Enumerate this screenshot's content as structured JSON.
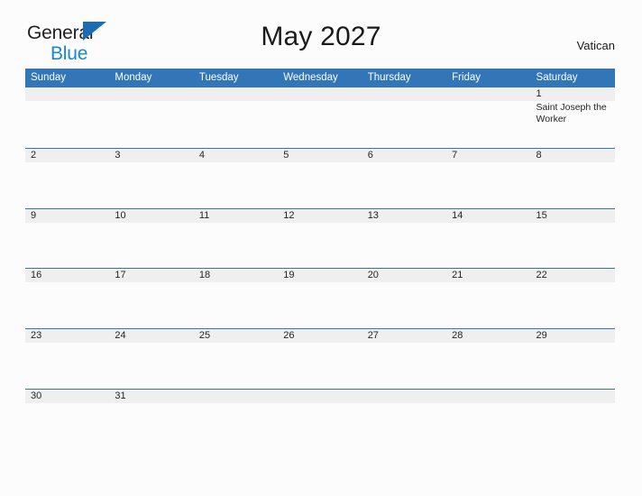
{
  "brand": {
    "line1": "General",
    "line2": "Blue",
    "flag_color": "#1b6cb0",
    "line2_color": "#1b86d4"
  },
  "header": {
    "title": "May 2027",
    "region": "Vatican",
    "accent_color": "#3276b8",
    "date_band_color": "#efefef"
  },
  "calendar": {
    "weekdays": [
      "Sunday",
      "Monday",
      "Tuesday",
      "Wednesday",
      "Thursday",
      "Friday",
      "Saturday"
    ],
    "weeks": [
      {
        "days": [
          {
            "num": "",
            "event": ""
          },
          {
            "num": "",
            "event": ""
          },
          {
            "num": "",
            "event": ""
          },
          {
            "num": "",
            "event": ""
          },
          {
            "num": "",
            "event": ""
          },
          {
            "num": "",
            "event": ""
          },
          {
            "num": "1",
            "event": "Saint Joseph the Worker"
          }
        ]
      },
      {
        "days": [
          {
            "num": "2",
            "event": ""
          },
          {
            "num": "3",
            "event": ""
          },
          {
            "num": "4",
            "event": ""
          },
          {
            "num": "5",
            "event": ""
          },
          {
            "num": "6",
            "event": ""
          },
          {
            "num": "7",
            "event": ""
          },
          {
            "num": "8",
            "event": ""
          }
        ]
      },
      {
        "days": [
          {
            "num": "9",
            "event": ""
          },
          {
            "num": "10",
            "event": ""
          },
          {
            "num": "11",
            "event": ""
          },
          {
            "num": "12",
            "event": ""
          },
          {
            "num": "13",
            "event": ""
          },
          {
            "num": "14",
            "event": ""
          },
          {
            "num": "15",
            "event": ""
          }
        ]
      },
      {
        "days": [
          {
            "num": "16",
            "event": ""
          },
          {
            "num": "17",
            "event": ""
          },
          {
            "num": "18",
            "event": ""
          },
          {
            "num": "19",
            "event": ""
          },
          {
            "num": "20",
            "event": ""
          },
          {
            "num": "21",
            "event": ""
          },
          {
            "num": "22",
            "event": ""
          }
        ]
      },
      {
        "days": [
          {
            "num": "23",
            "event": ""
          },
          {
            "num": "24",
            "event": ""
          },
          {
            "num": "25",
            "event": ""
          },
          {
            "num": "26",
            "event": ""
          },
          {
            "num": "27",
            "event": ""
          },
          {
            "num": "28",
            "event": ""
          },
          {
            "num": "29",
            "event": ""
          }
        ]
      },
      {
        "days": [
          {
            "num": "30",
            "event": ""
          },
          {
            "num": "31",
            "event": ""
          },
          {
            "num": "",
            "event": ""
          },
          {
            "num": "",
            "event": ""
          },
          {
            "num": "",
            "event": ""
          },
          {
            "num": "",
            "event": ""
          },
          {
            "num": "",
            "event": ""
          }
        ]
      }
    ]
  }
}
